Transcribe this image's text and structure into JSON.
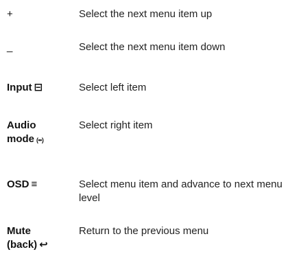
{
  "rows": [
    {
      "key": "+",
      "symbol": "",
      "description": "Select the next menu item up"
    },
    {
      "key": "_",
      "symbol": "",
      "description": "Select the next menu item down"
    },
    {
      "key": "Input",
      "symbol": "⊟",
      "symbol_icon": "input-source-icon",
      "description": "Select left item"
    },
    {
      "key_line1": "Audio",
      "key_line2": "mode",
      "symbol": "(••)",
      "symbol_icon": "audio-mode-icon",
      "description": "Select right item"
    },
    {
      "key": "OSD",
      "symbol": "≡",
      "symbol_icon": "menu-icon",
      "description": "Select menu item and advance to next menu level"
    },
    {
      "key_line1": "Mute",
      "key_line2": "(back)",
      "symbol": "↩",
      "symbol_icon": "back-arrow-icon",
      "description": "Return to the previous menu"
    }
  ]
}
